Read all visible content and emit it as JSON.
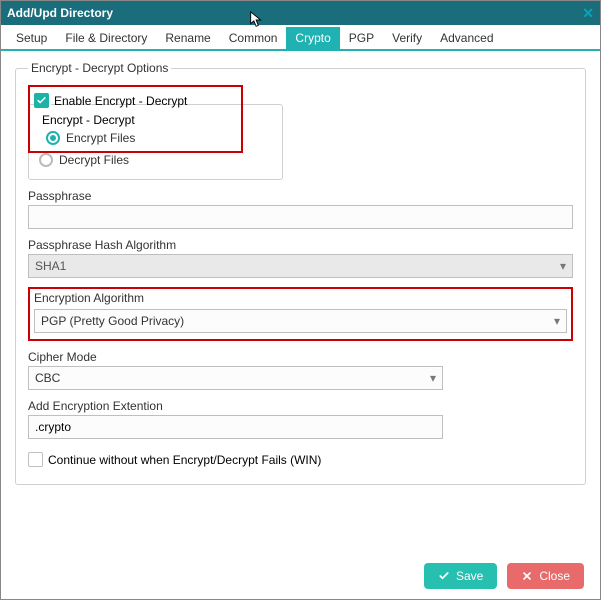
{
  "window": {
    "title": "Add/Upd Directory"
  },
  "tabs": {
    "setup": "Setup",
    "file_directory": "File & Directory",
    "rename": "Rename",
    "common": "Common",
    "crypto": "Crypto",
    "pgp": "PGP",
    "verify": "Verify",
    "advanced": "Advanced"
  },
  "group": {
    "legend": "Encrypt - Decrypt Options",
    "enable_label": "Enable Encrypt - Decrypt",
    "inner_legend": "Encrypt - Decrypt",
    "encrypt_files": "Encrypt Files",
    "decrypt_files": "Decrypt Files"
  },
  "fields": {
    "passphrase_label": "Passphrase",
    "passphrase_value": "",
    "hash_label": "Passphrase Hash Algorithm",
    "hash_value": "SHA1",
    "enc_alg_label": "Encryption Algorithm",
    "enc_alg_value": "PGP (Pretty Good Privacy)",
    "cipher_label": "Cipher Mode",
    "cipher_value": "CBC",
    "ext_label": "Add Encryption Extention",
    "ext_value": ".crypto",
    "continue_label": "Continue without when Encrypt/Decrypt Fails (WIN)"
  },
  "buttons": {
    "save": "Save",
    "close": "Close"
  }
}
